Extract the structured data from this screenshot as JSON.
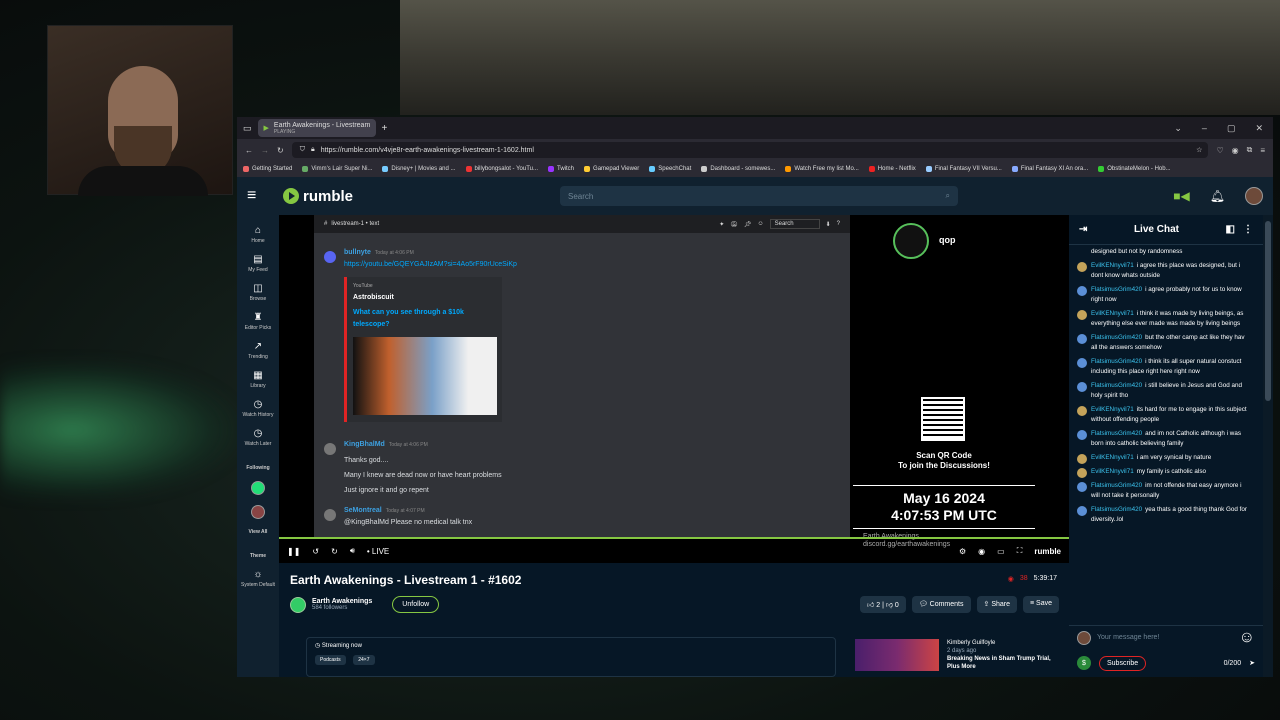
{
  "browser": {
    "tab_title": "Earth Awakenings - Livestream",
    "tab_sub": "PLAYING",
    "url": "https://rumble.com/v4vje8r-earth-awakenings-livestream-1-1602.html",
    "bookmarks": [
      "Getting Started",
      "Vimm's Lair Super Ni...",
      "Disney+ | Movies and ...",
      "billybongsalot - YouTu...",
      "Twitch",
      "Gamepad Viewer",
      "SpeechChat",
      "Dashboard - somewes...",
      "Watch Free my list Mo...",
      "Home - Netflix",
      "Final Fantasy VII Versu...",
      "Final Fantasy XI An ora...",
      "ObstinateMelon - Hob..."
    ]
  },
  "rumble": {
    "logo_text": "rumble",
    "search_placeholder": "Search"
  },
  "sidebar": {
    "items": [
      {
        "icon": "⌂",
        "label": "Home"
      },
      {
        "icon": "▤",
        "label": "My Feed"
      },
      {
        "icon": "◫",
        "label": "Browse"
      },
      {
        "icon": "♜",
        "label": "Editor Picks"
      },
      {
        "icon": "↗",
        "label": "Trending"
      },
      {
        "icon": "▦",
        "label": "Library"
      },
      {
        "icon": "◷",
        "label": "Watch History"
      },
      {
        "icon": "◷",
        "label": "Watch Later"
      }
    ],
    "following_label": "Following",
    "view_all": "View All",
    "theme_label": "Theme",
    "system_default": "System Default"
  },
  "discord": {
    "channel": "livestream-1 • text",
    "search_placeholder": "Search",
    "msg1_user": "bullnyte",
    "msg1_time": "Today at 4:06 PM",
    "msg1_link": "https://youtu.be/GQEYGAJIzAM?si=4Ao5rF90rUceSiKp",
    "embed_provider": "YouTube",
    "embed_author": "Astrobiscuit",
    "embed_title": "What can you see through a $10k telescope?",
    "msg2_user": "KingBhalMd",
    "msg2_time": "Today at 4:06 PM",
    "msg2_lines": [
      "Thanks god....",
      "Many I knew are dead now or have heart problems",
      "Just ignore it and go repent"
    ],
    "msg3_user": "SeMontreal",
    "msg3_time": "Today at 4:07 PM",
    "msg3_text": "@KingBhalMd Please no medical talk tnx"
  },
  "overlay": {
    "channel_name": "qop",
    "qr_caption_1": "Scan QR Code",
    "qr_caption_2": "To join the Discussions!",
    "date": "May 16 2024",
    "time": "4:07:53 PM UTC",
    "footer_name": "Earth Awakenings",
    "footer_link": "discord.gg/earthawakenings"
  },
  "player": {
    "live_label": "LIVE",
    "brand": "rumble"
  },
  "video": {
    "title": "Earth Awakenings - Livestream 1 - #1602",
    "viewers": "38",
    "duration": "5:39:17",
    "channel_name": "Earth Awakenings",
    "followers": "584 followers",
    "unfollow": "Unfollow",
    "likes": "2",
    "dislikes": "0",
    "comments": "Comments",
    "share": "Share",
    "save": "Save",
    "streaming_now": "Streaming now",
    "pills": [
      "Podcasts",
      "24×7"
    ],
    "rec_author": "Kimberly Guilfoyle",
    "rec_time": "2 days ago",
    "rec_title": "Breaking News in Sham Trump Trial, Plus More"
  },
  "chat": {
    "title": "Live Chat",
    "first_line": "designed but not by randomness",
    "messages": [
      {
        "user": "EvilKENnyvil71",
        "text": "i agree this place was designed, but i dont know whats outside",
        "color": "#c4a35a"
      },
      {
        "user": "FlatsimusGrim420",
        "text": "i agree probably not for us to know right now",
        "color": "#5b8fd6"
      },
      {
        "user": "EvilKENnyvil71",
        "text": "i think it was made by living beings, as everything else ever made was made by living beings",
        "color": "#c4a35a"
      },
      {
        "user": "FlatsimusGrim420",
        "text": "but the other camp act like they hav all the answers somehow",
        "color": "#5b8fd6"
      },
      {
        "user": "FlatsimusGrim420",
        "text": "i think its all super natural constuct including this place right here right now",
        "color": "#5b8fd6"
      },
      {
        "user": "FlatsimusGrim420",
        "text": "i still believe in Jesus and God and holy spirit tho",
        "color": "#5b8fd6"
      },
      {
        "user": "EvilKENnyvil71",
        "text": "its hard for me to engage in this subject without offending people",
        "color": "#c4a35a"
      },
      {
        "user": "FlatsimusGrim420",
        "text": "and im not Catholic although i was born into catholic believing family",
        "color": "#5b8fd6"
      },
      {
        "user": "EvilKENnyvil71",
        "text": "i am very synical by nature",
        "color": "#c4a35a"
      },
      {
        "user": "EvilKENnyvil71",
        "text": "my family is catholic also",
        "color": "#c4a35a"
      },
      {
        "user": "FlatsimusGrim420",
        "text": "im not offende that easy anymore i will not take it personally",
        "color": "#5b8fd6"
      },
      {
        "user": "FlatsimusGrim420",
        "text": "yea thats a good thing thank God for diversity..lol",
        "color": "#5b8fd6"
      }
    ],
    "input_placeholder": "Your message here!",
    "subscribe": "Subscribe",
    "char_count": "0/200"
  }
}
